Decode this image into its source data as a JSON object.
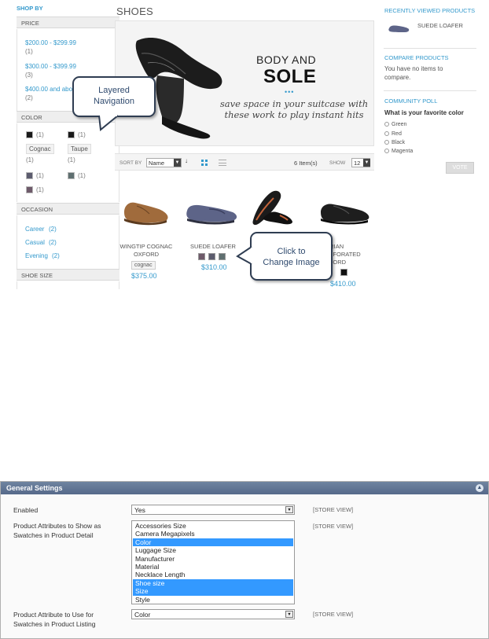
{
  "store": {
    "sidebar": {
      "title": "SHOP BY",
      "price": {
        "heading": "PRICE",
        "items": [
          {
            "label": "$200.00 - $299.99",
            "count": "(1)"
          },
          {
            "label": "$300.00 - $399.99",
            "count": "(3)"
          },
          {
            "label": "$400.00 and above",
            "count": "(2)"
          }
        ]
      },
      "color": {
        "heading": "COLOR",
        "swatches": [
          {
            "color": "#1a1a1a",
            "count": "(1)"
          },
          {
            "color": "#1a1a1a",
            "count": "(1)"
          },
          {
            "label": "Cognac",
            "count": "(1)"
          },
          {
            "label": "Taupe",
            "count": "(1)"
          },
          {
            "color": "#5c5c6e",
            "count": "(1)"
          },
          {
            "color": "#5f6f70",
            "count": "(1)"
          },
          {
            "color": "#6e5a6a",
            "count": "(1)"
          }
        ]
      },
      "occasion": {
        "heading": "OCCASION",
        "items": [
          {
            "label": "Career",
            "count": "(2)"
          },
          {
            "label": "Casual",
            "count": "(2)"
          },
          {
            "label": "Evening",
            "count": "(2)"
          }
        ]
      },
      "shoe_size": {
        "heading": "SHOE SIZE"
      }
    },
    "main": {
      "title": "SHOES",
      "banner": {
        "line1": "BODY AND",
        "line2": "SOLE",
        "dots": "•••",
        "tagline": "save space in your suitcase with these work to play instant hits"
      },
      "toolbar": {
        "sort_label": "SORT BY",
        "sort_value": "Name",
        "items_count": "6 Item(s)",
        "show_label": "SHOW",
        "show_value": "12"
      },
      "products": [
        {
          "name_line1": "WINGTIP COGNAC",
          "name_line2": "OXFORD",
          "chip": "cognac",
          "price": "$375.00"
        },
        {
          "name_line1": "SUEDE LOAFER",
          "price": "$310.00",
          "swatches": [
            "#6e5a6a",
            "#5c5c6e",
            "#5f6f70"
          ]
        },
        {
          "name_line1": "DORIAN",
          "name_line2": "PERFORATED",
          "name_line3": "OXFORD",
          "price": "$410.00",
          "swatches": [
            "#111111"
          ]
        }
      ]
    },
    "right": {
      "recent_heading": "RECENTLY VIEWED PRODUCTS",
      "recent_item": "SUEDE LOAFER",
      "compare_heading": "COMPARE PRODUCTS",
      "compare_text_line1": "You have no items to",
      "compare_text_line2": "compare.",
      "poll_heading": "COMMUNITY POLL",
      "poll_question": "What is your favorite color",
      "poll_options": [
        "Green",
        "Red",
        "Black",
        "Magenta"
      ],
      "vote_label": "VOTE"
    },
    "callouts": {
      "layered_line1": "Layered",
      "layered_line2": "Navigation",
      "change_line1": "Click to",
      "change_line2": "Change Image"
    }
  },
  "admin": {
    "section_title": "General Settings",
    "collapse_icon": "chevron-up-icon",
    "enabled": {
      "label": "Enabled",
      "value": "Yes",
      "scope": "[STORE VIEW]"
    },
    "detail": {
      "label_line1": "Product Attributes to Show as",
      "label_line2": "Swatches in Product Detail",
      "scope": "[STORE VIEW]",
      "options": [
        {
          "label": "Accessories Size",
          "selected": false
        },
        {
          "label": "Camera Megapixels",
          "selected": false
        },
        {
          "label": "Color",
          "selected": true
        },
        {
          "label": "Luggage Size",
          "selected": false
        },
        {
          "label": "Manufacturer",
          "selected": false
        },
        {
          "label": "Material",
          "selected": false
        },
        {
          "label": "Necklace Length",
          "selected": false
        },
        {
          "label": "Shoe size",
          "selected": true
        },
        {
          "label": "Size",
          "selected": true
        },
        {
          "label": "Style",
          "selected": false
        }
      ]
    },
    "listing": {
      "label_line1": "Product Attribute to Use for",
      "label_line2": "Swatches in Product Listing",
      "value": "Color",
      "scope": "[STORE VIEW]"
    }
  }
}
